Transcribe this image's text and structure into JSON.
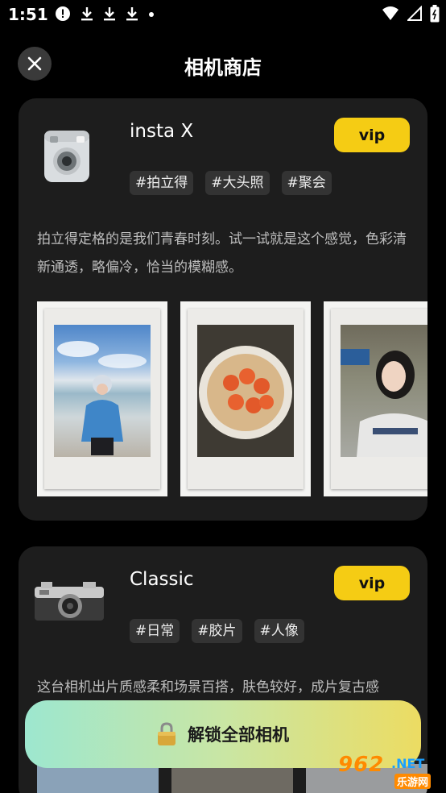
{
  "status_bar": {
    "time": "1:51"
  },
  "header": {
    "title": "相机商店"
  },
  "cameras": [
    {
      "name": "insta X",
      "vip_label": "vip",
      "tags": [
        "#拍立得",
        "#大头照",
        "#聚会"
      ],
      "description": "拍立得定格的是我们青春时刻。试一试就是这个感觉，色彩清新通透，略偏冷，恰当的模糊感。"
    },
    {
      "name": "Classic",
      "vip_label": "vip",
      "tags": [
        "#日常",
        "#胶片",
        "#人像"
      ],
      "description": "这台相机出片质感柔和场景百搭，肤色较好，成片复古感"
    }
  ],
  "unlock": {
    "label": "解锁全部相机"
  },
  "watermark": {
    "num": "962",
    "net": ".NET",
    "sub": "乐游网"
  },
  "colors": {
    "accent": "#f5cc14",
    "card_bg": "#1d1d1d",
    "tag_bg": "#333333"
  }
}
